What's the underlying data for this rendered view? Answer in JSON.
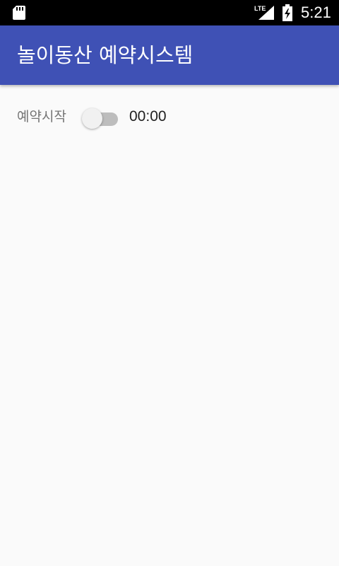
{
  "status_bar": {
    "network_label": "LTE",
    "time": "5:21",
    "icons": [
      "sd-card-icon",
      "lte-signal-icon",
      "battery-charging-icon"
    ]
  },
  "app_bar": {
    "title": "놀이동산 예약시스템",
    "color": "#3f51b5"
  },
  "reservation": {
    "label": "예약시작",
    "switch_on": false,
    "time": "00:00"
  }
}
